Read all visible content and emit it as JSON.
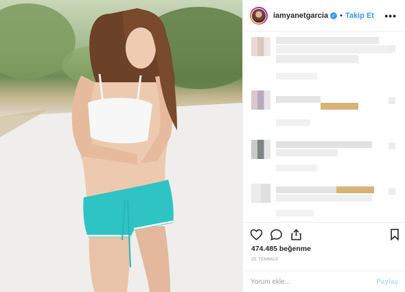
{
  "header": {
    "username": "iamyanetgarcia",
    "separator": "•",
    "follow_label": "Takip Et",
    "more_label": "•••"
  },
  "post": {
    "likes_text": "474.485 beğenme",
    "date_text": "25 TEMMUZ"
  },
  "comment_form": {
    "placeholder": "Yorum ekle...",
    "post_label": "Paylaş"
  },
  "icons": {
    "verified": "verified-badge-icon",
    "like": "heart-icon",
    "comment": "comment-bubble-icon",
    "share": "share-icon",
    "save": "bookmark-icon",
    "more": "more-dots-icon"
  },
  "colors": {
    "link_blue": "#3897f0",
    "post_button_disabled": "#b2dffc",
    "text": "#262626",
    "muted": "#999999",
    "border": "#efefef",
    "shorts": "#2fc4c4"
  }
}
